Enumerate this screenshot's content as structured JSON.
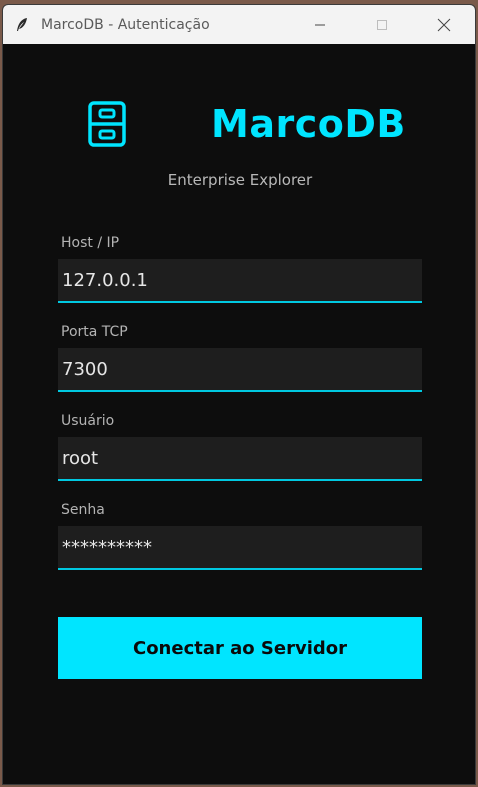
{
  "window": {
    "title": "MarcoDB - Autenticação"
  },
  "brand": {
    "name": "MarcoDB",
    "subtitle": "Enterprise Explorer",
    "accent": "#00e5ff"
  },
  "form": {
    "host": {
      "label": "Host / IP",
      "value": "127.0.0.1"
    },
    "port": {
      "label": "Porta TCP",
      "value": "7300"
    },
    "user": {
      "label": "Usuário",
      "value": "root"
    },
    "password": {
      "label": "Senha",
      "value": "**********"
    }
  },
  "connect_button": {
    "label": "Conectar ao Servidor"
  },
  "icons": {
    "app": "feather-icon",
    "logo": "file-cabinet-icon",
    "minimize": "minimize-icon",
    "maximize": "maximize-icon",
    "close": "close-icon"
  }
}
